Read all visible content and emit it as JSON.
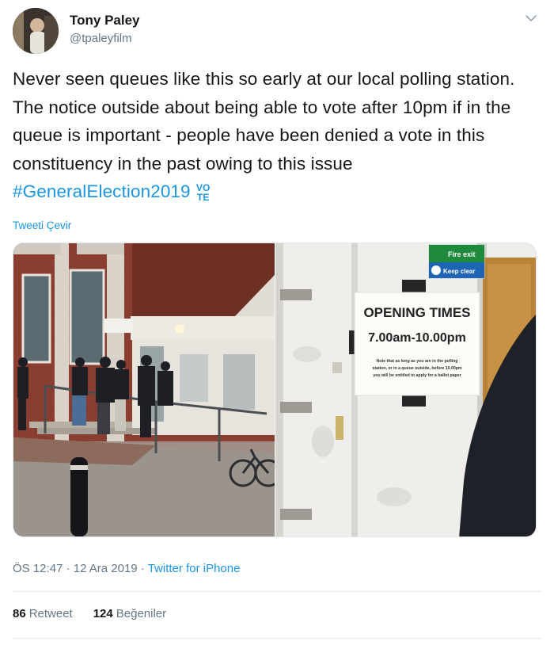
{
  "author": {
    "name": "Tony Paley",
    "handle": "@tpaleyfilm"
  },
  "tweet": {
    "text": "Never seen queues like this so early at our local polling station. The notice outside about being able to vote after 10pm if in the queue is important - people have been denied  a vote in this constituency in the past owing to this issue ",
    "hashtag": "#GeneralElection2019",
    "emoji_top": "VO",
    "emoji_bottom": "TE"
  },
  "translate_label": "Tweeti Çevir",
  "media": {
    "right_photo": {
      "sign_title": "OPENING TIMES",
      "sign_hours": "7.00am-10.00pm",
      "sign_note_1": "Note that as long as you are in the polling",
      "sign_note_2": "station, or in a queue outside, before 10.00pm",
      "sign_note_3": "you will be entitled to apply for a ballot paper",
      "fire_exit": "Fire exit",
      "keep_clear": "Keep clear"
    }
  },
  "meta": {
    "time": "ÖS 12:47",
    "date": "12 Ara 2019",
    "separator": "·",
    "source": "Twitter for iPhone"
  },
  "stats": {
    "retweets_count": "86",
    "retweets_label": "Retweet",
    "likes_count": "124",
    "likes_label": "Beğeniler"
  },
  "colors": {
    "link": "#1b95e0",
    "text": "#14171a",
    "secondary": "#657786"
  }
}
